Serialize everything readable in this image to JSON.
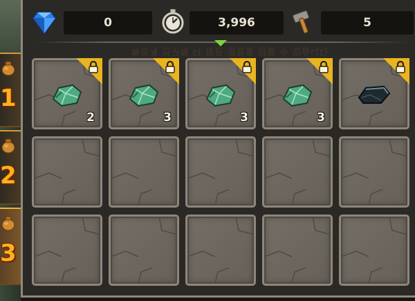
{
  "currencies": [
    {
      "icon": "diamond-gem-icon",
      "value": "0"
    },
    {
      "icon": "stopwatch-icon",
      "value": "3,996"
    },
    {
      "icon": "hammer-icon",
      "value": "5"
    }
  ],
  "side_tabs": [
    {
      "number": "1",
      "icon": "pouch-icon",
      "active": false
    },
    {
      "number": "2",
      "icon": "pouch-icon",
      "active": false
    },
    {
      "number": "3",
      "icon": "pouch-icon",
      "active": true
    }
  ],
  "background_text": "빠르게 연구해 더 많은 경험을 얻을 수 있습니다",
  "colors": {
    "lock_corner": "#e8b420",
    "tab_number": "#ffb020",
    "indicator_arrow": "#7fd63a",
    "ore_green": "#4fa982"
  },
  "slots": [
    {
      "item": "green-ore-icon",
      "quantity": "2",
      "locked": true
    },
    {
      "item": "green-ore-icon",
      "quantity": "3",
      "locked": true
    },
    {
      "item": "green-ore-icon",
      "quantity": "3",
      "locked": true
    },
    {
      "item": "green-ore-icon",
      "quantity": "3",
      "locked": true
    },
    {
      "item": "dark-ore-icon",
      "quantity": "",
      "locked": true
    },
    {
      "item": "",
      "quantity": "",
      "locked": false
    },
    {
      "item": "",
      "quantity": "",
      "locked": false
    },
    {
      "item": "",
      "quantity": "",
      "locked": false
    },
    {
      "item": "",
      "quantity": "",
      "locked": false
    },
    {
      "item": "",
      "quantity": "",
      "locked": false
    },
    {
      "item": "",
      "quantity": "",
      "locked": false
    },
    {
      "item": "",
      "quantity": "",
      "locked": false
    },
    {
      "item": "",
      "quantity": "",
      "locked": false
    },
    {
      "item": "",
      "quantity": "",
      "locked": false
    },
    {
      "item": "",
      "quantity": "",
      "locked": false
    }
  ]
}
